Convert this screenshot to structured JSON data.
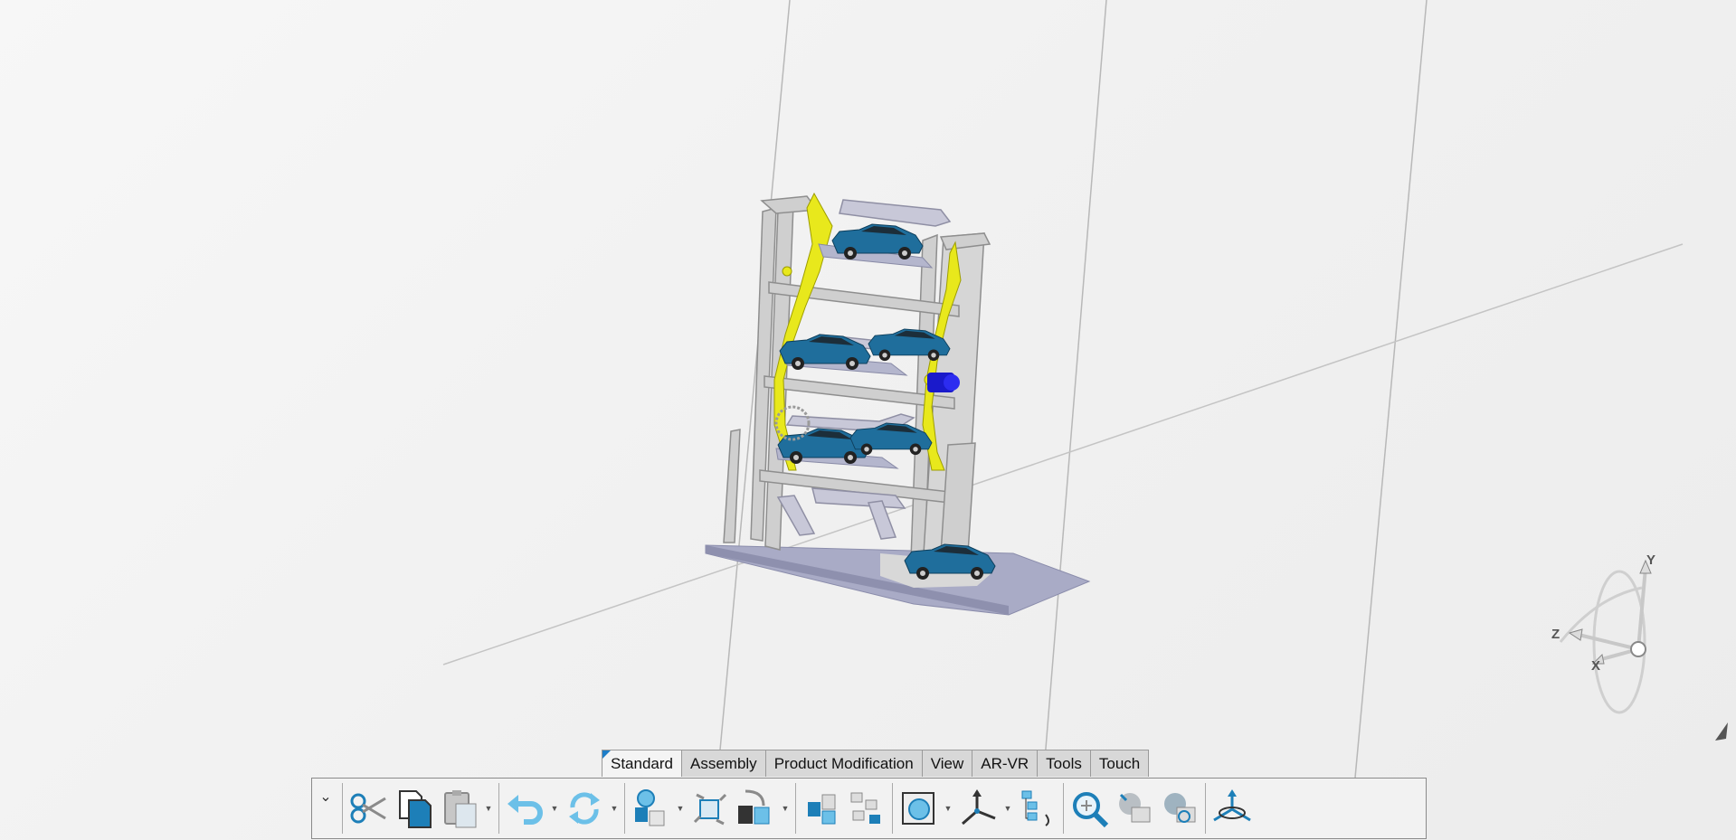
{
  "tabs": [
    {
      "label": "Standard",
      "active": true
    },
    {
      "label": "Assembly",
      "active": false
    },
    {
      "label": "Product Modification",
      "active": false
    },
    {
      "label": "View",
      "active": false
    },
    {
      "label": "AR-VR",
      "active": false
    },
    {
      "label": "Tools",
      "active": false
    },
    {
      "label": "Touch",
      "active": false
    }
  ],
  "toolbar": {
    "collapse_icon": "chevron-down-icon",
    "tools": [
      {
        "name": "cut-button",
        "icon": "scissors-icon"
      },
      {
        "name": "copy-button",
        "icon": "copy-icon"
      },
      {
        "name": "paste-button",
        "icon": "paste-icon",
        "dropdown": true
      },
      {
        "name": "undo-button",
        "icon": "undo-icon",
        "dropdown": true
      },
      {
        "name": "update-button",
        "icon": "update-icon",
        "dropdown": true
      },
      {
        "name": "catalog-button",
        "icon": "catalog-icon",
        "dropdown": true
      },
      {
        "name": "manipulate-button",
        "icon": "manipulate-icon"
      },
      {
        "name": "select-button",
        "icon": "select-icon",
        "dropdown": true
      },
      {
        "name": "explode-button",
        "icon": "explode-icon"
      },
      {
        "name": "product-structure-button",
        "icon": "structure-icon"
      },
      {
        "name": "section-button",
        "icon": "section-icon",
        "dropdown": true
      },
      {
        "name": "axis-system-button",
        "icon": "axis-icon",
        "dropdown": true
      },
      {
        "name": "tree-reorder-button",
        "icon": "tree-reorder-icon"
      },
      {
        "name": "fit-all-button",
        "icon": "zoom-fit-icon"
      },
      {
        "name": "hide-show-button",
        "icon": "hide-show-icon"
      },
      {
        "name": "swap-visible-button",
        "icon": "swap-icon"
      },
      {
        "name": "compass-button",
        "icon": "compass-icon"
      }
    ]
  },
  "compass": {
    "x_label": "X",
    "y_label": "Y",
    "z_label": "Z"
  },
  "colors": {
    "accent": "#1e7ec8",
    "car_body": "#1f6e9c",
    "frame": "#c9c9c9",
    "bracket": "#e6e61a",
    "base": "#a7a9c4"
  }
}
